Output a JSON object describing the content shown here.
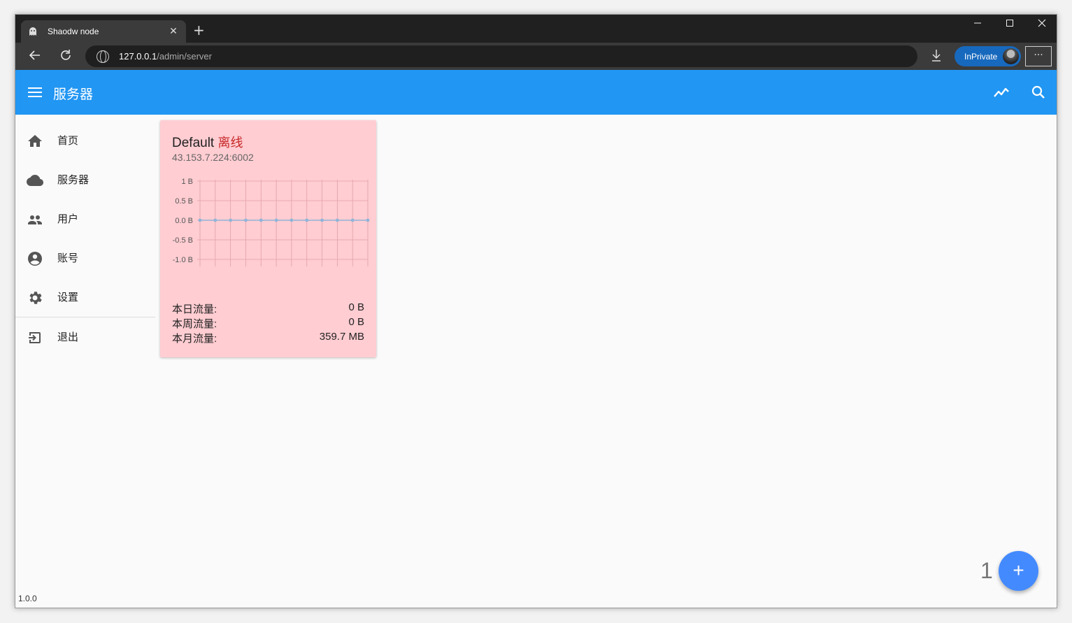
{
  "browser": {
    "tab_title": "Shaodw node",
    "url_host": "127.0.0.1",
    "url_path": "/admin/server",
    "inprivate_label": "InPrivate",
    "more_label": "···"
  },
  "appbar": {
    "title": "服务器"
  },
  "sidebar": {
    "items": [
      {
        "label": "首页",
        "icon": "home-icon"
      },
      {
        "label": "服务器",
        "icon": "cloud-icon"
      },
      {
        "label": "用户",
        "icon": "people-icon"
      },
      {
        "label": "账号",
        "icon": "account-circle-icon"
      },
      {
        "label": "设置",
        "icon": "gear-icon"
      },
      {
        "label": "退出",
        "icon": "logout-icon"
      }
    ],
    "version": "1.0.0"
  },
  "server_card": {
    "name": "Default",
    "status": "离线",
    "status_color": "#c62828",
    "background": "#ffcdd2",
    "address": "43.153.7.224:6002",
    "stats": [
      {
        "label": "本日流量:",
        "value": "0 B"
      },
      {
        "label": "本周流量:",
        "value": "0 B"
      },
      {
        "label": "本月流量:",
        "value": "359.7 MB"
      }
    ]
  },
  "chart_data": {
    "type": "line",
    "title": "",
    "xlabel": "",
    "ylabel": "",
    "y_tick_labels": [
      "1 B",
      "0.5 B",
      "0.0 B",
      "-0.5 B",
      "-1.0 B"
    ],
    "ylim": [
      -1.0,
      1.0
    ],
    "x": [
      0,
      1,
      2,
      3,
      4,
      5,
      6,
      7,
      8,
      9,
      10,
      11
    ],
    "series": [
      {
        "values": [
          0,
          0,
          0,
          0,
          0,
          0,
          0,
          0,
          0,
          0,
          0,
          0
        ],
        "color": "#90b4d8"
      }
    ],
    "grid": true
  },
  "pagination": {
    "count": "1"
  },
  "fab": {
    "label": "+"
  },
  "colors": {
    "primary": "#2196f3",
    "fab": "#448aff"
  }
}
